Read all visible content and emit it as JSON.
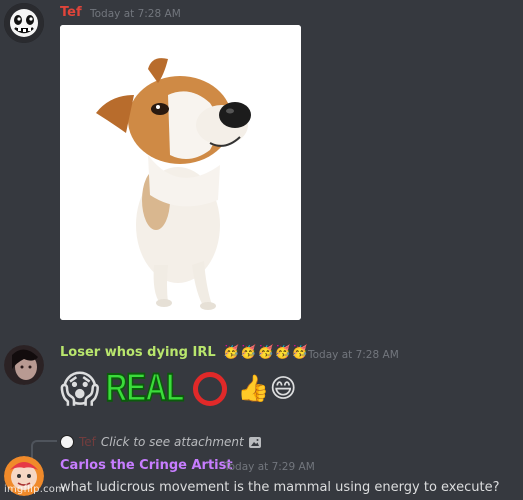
{
  "messages": [
    {
      "author": "Tef",
      "author_color": "#e0443a",
      "timestamp": "Today at 7:28 AM",
      "attachment_icon": "jack-russell-terrier-photo"
    },
    {
      "author": "Loser whos dying IRL",
      "author_color": "#b9e66d",
      "badge_emoji": [
        "🥳",
        "🥳",
        "🥳",
        "🥳",
        "🥳"
      ],
      "timestamp": "Today at 7:28 AM",
      "content_emoji": {
        "scream": "😱",
        "real_text": "REAL",
        "circle_icon": "red-circle-icon",
        "thumbs": "👍😄"
      }
    },
    {
      "reply_to": {
        "author": "Tef",
        "text": "Click to see attachment",
        "icon": "image-icon"
      },
      "author": "Carlos the Cringe Artist",
      "author_color": "#c77dff",
      "timestamp": "Today at 7:29 AM",
      "text": "what ludicrous movement is the mammal using energy to execute?"
    }
  ],
  "watermark": "imgflip.com",
  "colors": {
    "background": "#36393f",
    "timestamp": "#72767d",
    "text": "#dcddde"
  }
}
